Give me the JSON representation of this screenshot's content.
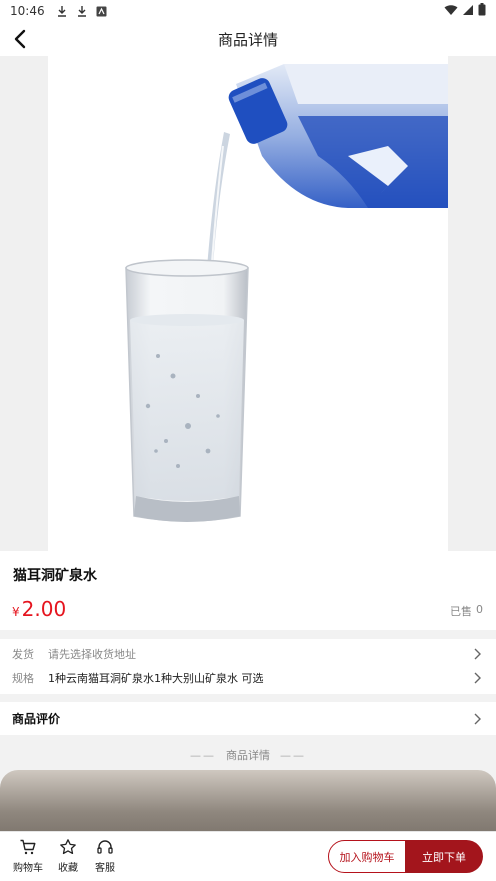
{
  "status_bar": {
    "time": "10:46"
  },
  "header": {
    "title": "商品详情"
  },
  "product": {
    "name": "猫耳洞矿泉水",
    "currency": "¥",
    "price": "2.00",
    "sold_label": "已售",
    "sold_count": "0"
  },
  "options": {
    "ship_label": "发货",
    "ship_value": "请先选择收货地址",
    "spec_label": "规格",
    "spec_value": "1种云南猫耳洞矿泉水1种大别山矿泉水 可选"
  },
  "review": {
    "label": "商品评价"
  },
  "detail_header": {
    "line": "——",
    "label": "商品详情"
  },
  "bottom_bar": {
    "tabs": [
      {
        "label": "购物车",
        "icon": "cart-icon"
      },
      {
        "label": "收藏",
        "icon": "star-icon"
      },
      {
        "label": "客服",
        "icon": "headset-icon"
      }
    ],
    "add_to_cart": "加入购物车",
    "buy_now": "立即下单"
  },
  "colors": {
    "price": "#e5141e",
    "brand": "#a3151c"
  }
}
